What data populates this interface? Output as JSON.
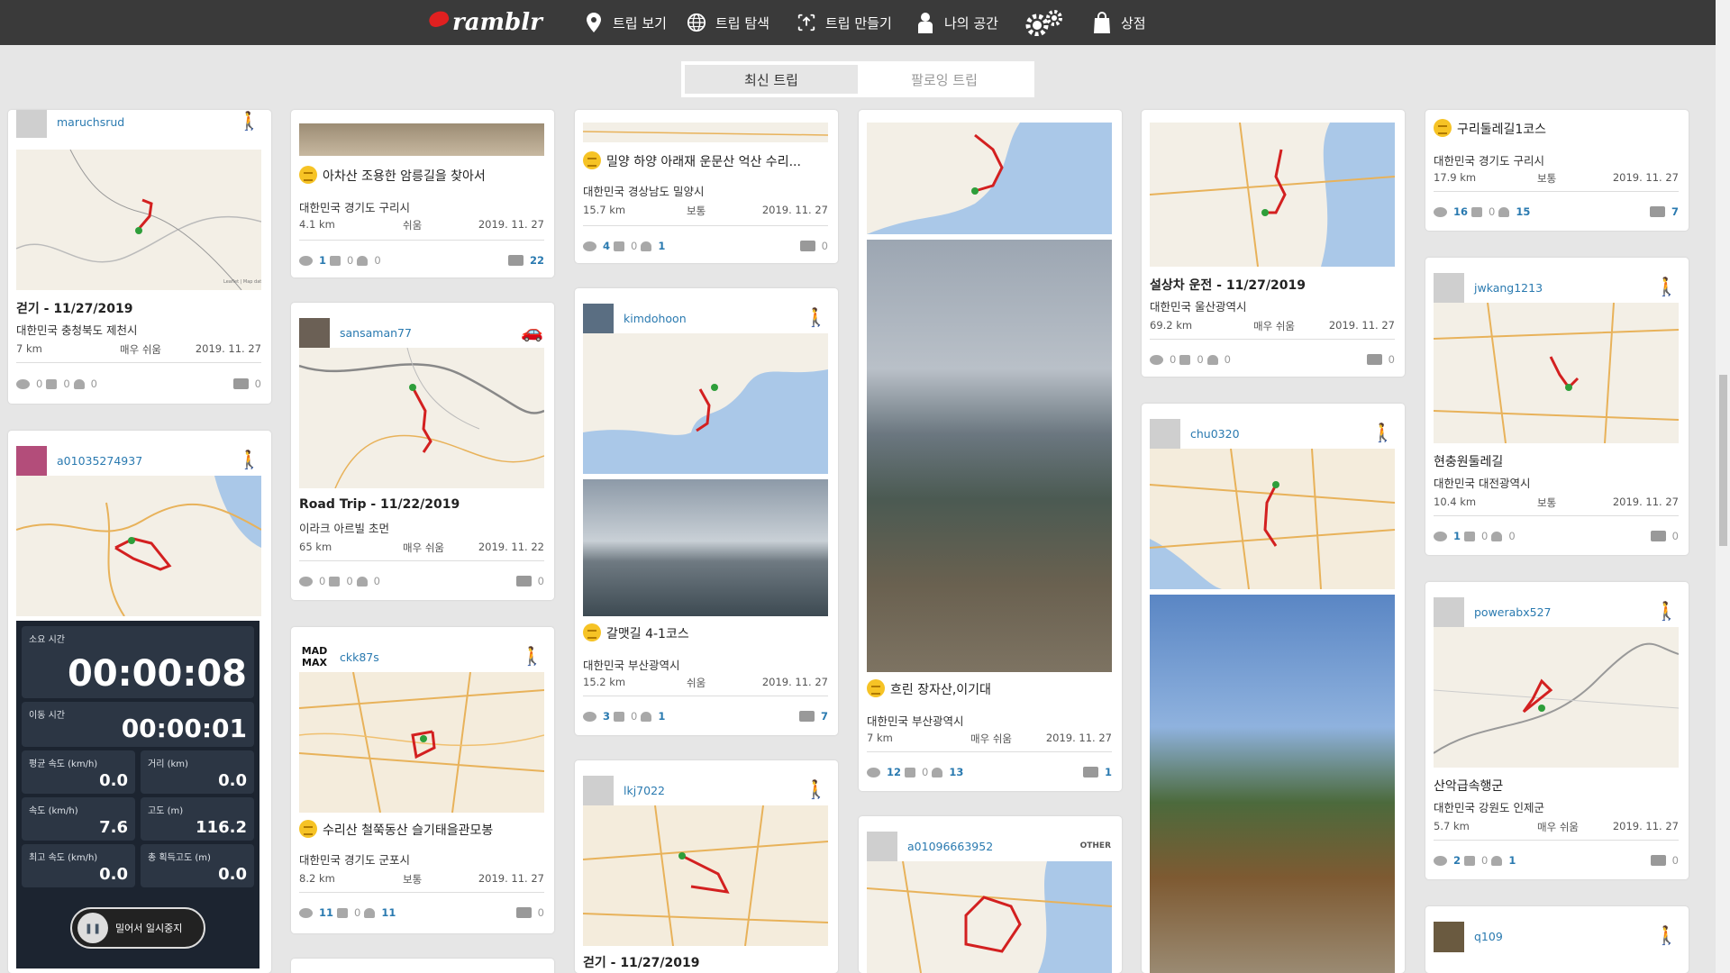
{
  "header": {
    "logo": "ramblr",
    "nav": [
      {
        "label": "트립 보기",
        "icon": "map-pin-icon"
      },
      {
        "label": "트립 탐색",
        "icon": "globe-icon"
      },
      {
        "label": "트립 만들기",
        "icon": "upload-icon"
      },
      {
        "label": "나의 공간",
        "icon": "user-icon"
      },
      {
        "label": "",
        "icon": "gears-icon"
      },
      {
        "label": "상점",
        "icon": "shopping-bag-icon"
      }
    ]
  },
  "tabs": [
    {
      "label": "최신 트립",
      "active": true
    },
    {
      "label": "팔로잉 트립",
      "active": false
    }
  ],
  "cards": {
    "c1a": {
      "user": "maruchsrud",
      "title": "걷기 - 11/27/2019",
      "location": "대한민국 충청북도 제천시",
      "distance": "7 km",
      "difficulty": "매우 쉬움",
      "date": "2019. 11. 27",
      "views": "0",
      "comments": "0",
      "likes": "0",
      "photos": "0"
    },
    "c1b": {
      "user": "a01035274937"
    },
    "c2a": {
      "title": "아차산 조용한 암릉길을 찾아서",
      "location": "대한민국 경기도 구리시",
      "distance": "4.1 km",
      "difficulty": "쉬움",
      "date": "2019. 11. 27",
      "views": "1",
      "comments": "0",
      "likes": "0",
      "photos": "22"
    },
    "c2b": {
      "user": "sansaman77",
      "title": "Road Trip - 11/22/2019",
      "location": "이라크 아르빌 초먼",
      "distance": "65 km",
      "difficulty": "매우 쉬움",
      "date": "2019. 11. 22",
      "views": "0",
      "comments": "0",
      "likes": "0",
      "photos": "0"
    },
    "c2c": {
      "user": "ckk87s",
      "avatar_text": "MAD MAX",
      "title": "수리산 철쭉동산 슬기태을관모봉",
      "location": "대한민국 경기도 군포시",
      "distance": "8.2 km",
      "difficulty": "보통",
      "date": "2019. 11. 27",
      "views": "11",
      "comments": "0",
      "likes": "11",
      "photos": "0"
    },
    "c3a": {
      "title": "밀양 하양 아래재 운문산 억산 수리...",
      "location": "대한민국 경상남도 밀양시",
      "distance": "15.7 km",
      "difficulty": "보통",
      "date": "2019. 11. 27",
      "views": "4",
      "comments": "0",
      "likes": "1",
      "photos": "0"
    },
    "c3b": {
      "user": "kimdohoon",
      "title": "갈맷길 4-1코스",
      "location": "대한민국 부산광역시",
      "distance": "15.2 km",
      "difficulty": "쉬움",
      "date": "2019. 11. 27",
      "views": "3",
      "comments": "0",
      "likes": "1",
      "photos": "7"
    },
    "c3c": {
      "user": "lkj7022",
      "title": "걷기 - 11/27/2019"
    },
    "c4a": {
      "title": "흐린 장자산,이기대",
      "location": "대한민국 부산광역시",
      "distance": "7 km",
      "difficulty": "매우 쉬움",
      "date": "2019. 11. 27",
      "views": "12",
      "comments": "0",
      "likes": "13",
      "photos": "1"
    },
    "c4b": {
      "user": "a01096663952",
      "activity": "OTHER"
    },
    "c5a": {
      "title": "설상차 운전 - 11/27/2019",
      "location": "대한민국 울산광역시",
      "distance": "69.2 km",
      "difficulty": "매우 쉬움",
      "date": "2019. 11. 27",
      "views": "0",
      "comments": "0",
      "likes": "0",
      "photos": "0"
    },
    "c5b": {
      "user": "chu0320"
    },
    "c6a": {
      "title": "구리둘레길1코스",
      "location": "대한민국 경기도 구리시",
      "distance": "17.9 km",
      "difficulty": "보통",
      "date": "2019. 11. 27",
      "views": "16",
      "comments": "0",
      "likes": "15",
      "photos": "7"
    },
    "c6b": {
      "user": "jwkang1213",
      "title": "현충원둘레길",
      "location": "대한민국 대전광역시",
      "distance": "10.4 km",
      "difficulty": "보통",
      "date": "2019. 11. 27",
      "views": "1",
      "comments": "0",
      "likes": "0",
      "photos": "0"
    },
    "c6c": {
      "user": "powerabx527",
      "title": "산악급속행군",
      "location": "대한민국 강원도 인제군",
      "distance": "5.7 km",
      "difficulty": "매우 쉬움",
      "date": "2019. 11. 27",
      "views": "2",
      "comments": "0",
      "likes": "1",
      "photos": "0"
    },
    "c6d": {
      "user": "q109"
    }
  },
  "tracker": {
    "elapsed_label": "소요 시간",
    "elapsed": "00:00:08",
    "moving_label": "이동 시간",
    "moving": "00:00:01",
    "avg_speed_label": "평균 속도 (km/h)",
    "avg_speed": "0.0",
    "distance_label": "거리 (km)",
    "distance": "0.0",
    "speed_label": "속도 (km/h)",
    "speed": "7.6",
    "altitude_label": "고도 (m)",
    "altitude": "116.2",
    "max_speed_label": "최고 속도 (km/h)",
    "max_speed": "0.0",
    "ascent_label": "총 획득고도 (m)",
    "ascent": "0.0",
    "pause_label": "밀어서 일시중지"
  },
  "colors": {
    "route": "#d32020",
    "link": "#2a7ab0",
    "header": "#3a3a3a",
    "badge": "#f6c325"
  }
}
